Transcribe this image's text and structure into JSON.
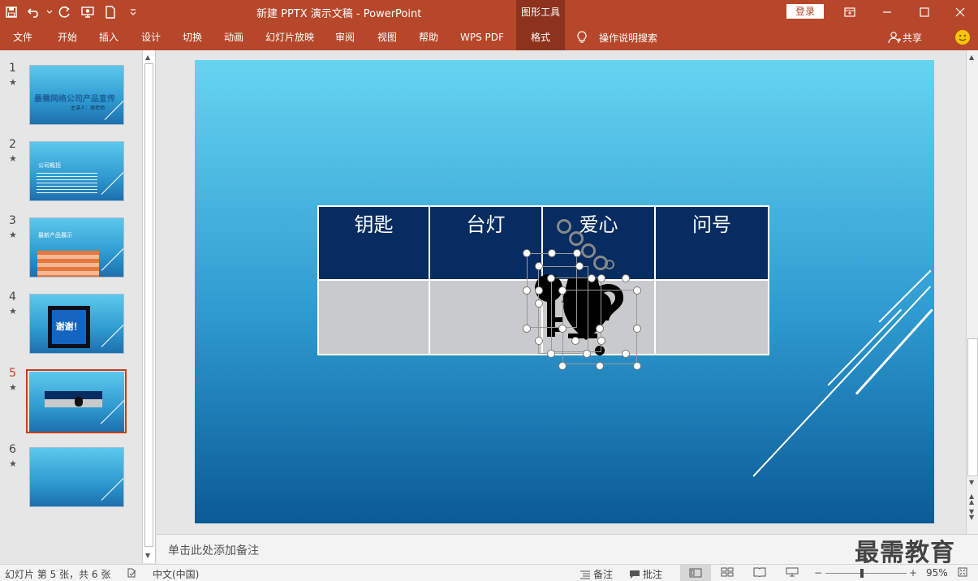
{
  "titlebar": {
    "title": "新建 PPTX 演示文稿  -  PowerPoint",
    "context_group": "图形工具",
    "login": "登录"
  },
  "tabs": [
    "文件",
    "开始",
    "插入",
    "设计",
    "切换",
    "动画",
    "幻灯片放映",
    "审阅",
    "视图",
    "帮助",
    "WPS PDF",
    "格式"
  ],
  "active_tab": "格式",
  "tellme": "操作说明搜索",
  "share": "共享",
  "thumbnails": [
    {
      "num": "1",
      "star": "★",
      "title": "最需网络公司产品宣传",
      "subtitle": "主讲人：周老师"
    },
    {
      "num": "2",
      "star": "★",
      "title": "公司概括"
    },
    {
      "num": "3",
      "star": "★",
      "title": "最新产品展示"
    },
    {
      "num": "4",
      "star": "★",
      "title": "谢谢！"
    },
    {
      "num": "5",
      "star": "★"
    },
    {
      "num": "6",
      "star": "★"
    }
  ],
  "selected_slide": 5,
  "slide": {
    "table_headers": [
      "钥匙",
      "台灯",
      "爱心",
      "问号"
    ]
  },
  "notes_placeholder": "单击此处添加备注",
  "watermark": "最需教育",
  "statusbar": {
    "slide_info": "幻灯片 第 5 张，共 6 张",
    "language": "中文(中国)",
    "notes": "备注",
    "comments": "批注",
    "zoom": "95%"
  },
  "colors": {
    "ribbon": "#b7472a",
    "context_tab": "#8d321c",
    "table_header": "#062c61",
    "table_body": "#c9cacc",
    "selected_thumb_border": "#c43e1c"
  }
}
